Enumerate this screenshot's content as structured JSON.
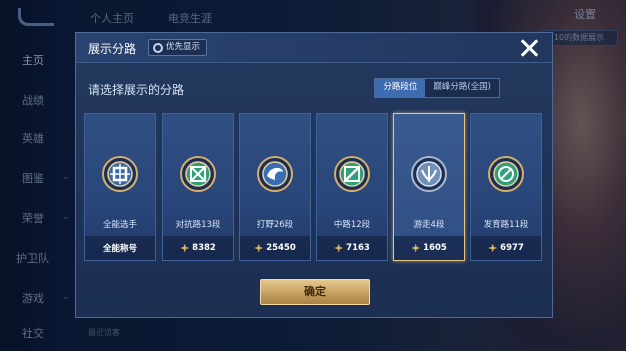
{
  "background": {
    "top_tabs": [
      "个人主页",
      "电竞生涯"
    ],
    "top_right_label": "设置",
    "hint_chip": "10的数据展示",
    "side_nav": [
      "主页",
      "战绩",
      "英雄",
      "图鉴",
      "荣誉",
      "护卫队",
      "游戏",
      "社交"
    ],
    "bottom_hint": "最近访客"
  },
  "modal": {
    "title": "展示分路",
    "priority_chip": "优先显示",
    "prompt": "请选择展示的分路",
    "tabs": [
      {
        "label": "分路段位",
        "active": true
      },
      {
        "label": "巅峰分路(全国)",
        "active": false
      }
    ],
    "cards": [
      {
        "label": "全能选手",
        "value": "全能称号",
        "show_star": false,
        "selected": false,
        "emblem": "all-round-emblem-icon"
      },
      {
        "label": "对抗路13段",
        "value": "8382",
        "show_star": true,
        "selected": false,
        "emblem": "clash-lane-emblem-icon"
      },
      {
        "label": "打野26段",
        "value": "25450",
        "show_star": true,
        "selected": false,
        "emblem": "jungle-emblem-icon"
      },
      {
        "label": "中路12段",
        "value": "7163",
        "show_star": true,
        "selected": false,
        "emblem": "mid-lane-emblem-icon"
      },
      {
        "label": "游走4段",
        "value": "1605",
        "show_star": true,
        "selected": true,
        "emblem": "roam-emblem-icon"
      },
      {
        "label": "发育路11段",
        "value": "6977",
        "show_star": true,
        "selected": false,
        "emblem": "farm-lane-emblem-icon"
      }
    ],
    "confirm_label": "确定"
  },
  "colors": {
    "gold": "#d9b364",
    "accent_blue": "#3e6cb0",
    "selected_border": "#e4c585"
  }
}
